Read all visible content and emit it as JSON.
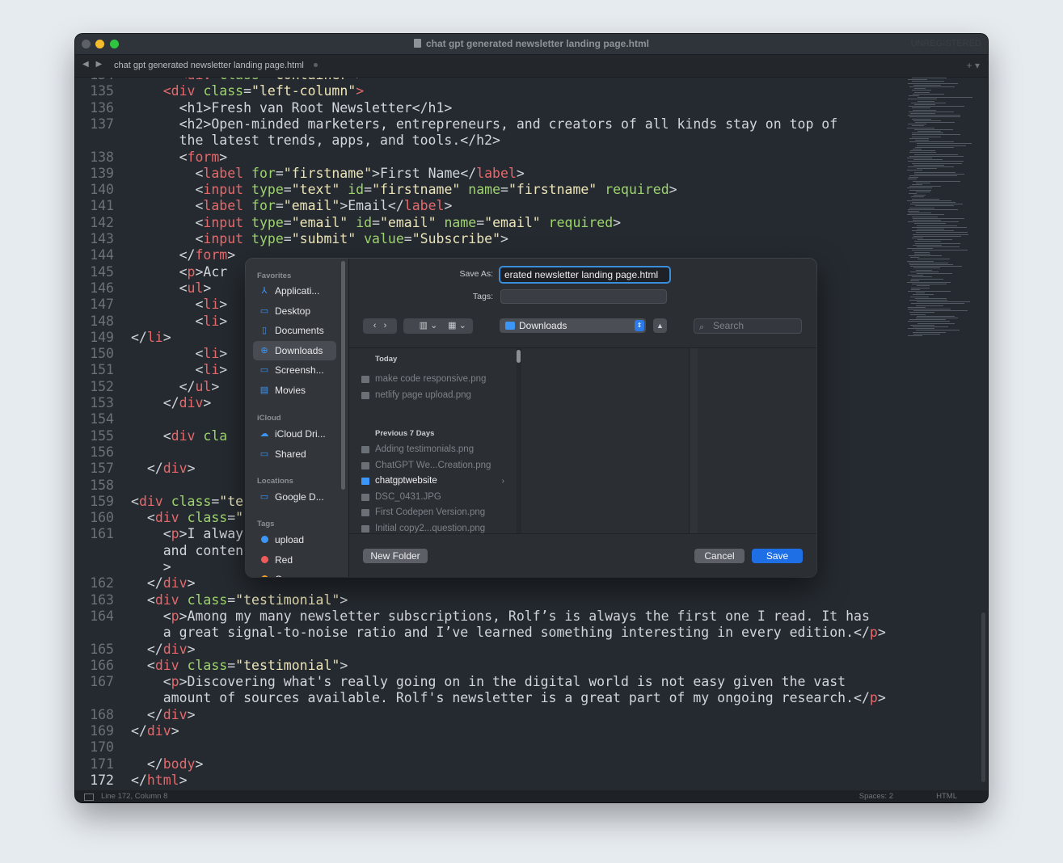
{
  "window": {
    "title": "chat gpt generated newsletter landing page.html",
    "unregistered": "UNREGISTERED",
    "tab_label": "chat gpt generated newsletter landing page.html",
    "tab_nav": "◀ ▶",
    "tab_actions": "+ ▾"
  },
  "editor": {
    "lines": [
      {
        "n": "134",
        "html": "      <span class='tg'>&lt;div</span> <span class='at'>class</span>=<span class='st'>\"container\"</span><span class='tg'>&gt;</span>"
      },
      {
        "n": "135",
        "html": "    <span class='tg'>&lt;div</span> <span class='at'>class</span>=<span class='st'>\"left-column\"</span><span class='tg'>&gt;</span>"
      },
      {
        "n": "136",
        "html": "      &lt;h1&gt;Fresh van Root Newsletter&lt;/h1&gt;"
      },
      {
        "n": "137",
        "html": "      &lt;h2&gt;Open-minded marketers, entrepreneurs, and creators of all kinds stay on top of"
      },
      {
        "n": "",
        "html": "      the latest trends, apps, and tools.&lt;/h2&gt;"
      },
      {
        "n": "138",
        "html": "      &lt;<span class='tg'>form</span>&gt;"
      },
      {
        "n": "139",
        "html": "        &lt;<span class='tg'>label</span> <span class='at'>for</span>=<span class='st'>\"firstname\"</span>&gt;First Name&lt;/<span class='tg'>label</span>&gt;"
      },
      {
        "n": "140",
        "html": "        &lt;<span class='tg'>input</span> <span class='at'>type</span>=<span class='st'>\"text\"</span> <span class='at'>id</span>=<span class='st'>\"firstname\"</span> <span class='at'>name</span>=<span class='st'>\"firstname\"</span> <span class='at'>required</span>&gt;"
      },
      {
        "n": "141",
        "html": "        &lt;<span class='tg'>label</span> <span class='at'>for</span>=<span class='st'>\"email\"</span>&gt;Email&lt;/<span class='tg'>label</span>&gt;"
      },
      {
        "n": "142",
        "html": "        &lt;<span class='tg'>input</span> <span class='at'>type</span>=<span class='st'>\"email\"</span> <span class='at'>id</span>=<span class='st'>\"email\"</span> <span class='at'>name</span>=<span class='st'>\"email\"</span> <span class='at'>required</span>&gt;"
      },
      {
        "n": "143",
        "html": "        &lt;<span class='tg'>input</span> <span class='at'>type</span>=<span class='st'>\"submit\"</span> <span class='at'>value</span>=<span class='st'>\"Subscribe\"</span>&gt;"
      },
      {
        "n": "144",
        "html": "      &lt;/<span class='tg'>form</span>&gt;"
      },
      {
        "n": "145",
        "html": "      &lt;<span class='tg'>p</span>&gt;Acr"
      },
      {
        "n": "146",
        "html": "      &lt;<span class='tg'>ul</span>&gt;"
      },
      {
        "n": "147",
        "html": "        &lt;<span class='tg'>li</span>&gt;"
      },
      {
        "n": "148",
        "html": "        &lt;<span class='tg'>li</span>&gt;"
      },
      {
        "n": "149",
        "html": "&lt;/<span class='tg'>li</span>&gt;"
      },
      {
        "n": "150",
        "html": "        &lt;<span class='tg'>li</span>&gt;"
      },
      {
        "n": "151",
        "html": "        &lt;<span class='tg'>li</span>&gt;"
      },
      {
        "n": "152",
        "html": "      &lt;/<span class='tg'>ul</span>&gt;"
      },
      {
        "n": "153",
        "html": "    &lt;/<span class='tg'>div</span>&gt;"
      },
      {
        "n": "154",
        "html": ""
      },
      {
        "n": "155",
        "html": "    &lt;<span class='tg'>div</span> <span class='at'>cla</span>"
      },
      {
        "n": "156",
        "html": ""
      },
      {
        "n": "157",
        "html": "  &lt;/<span class='tg'>div</span>&gt;"
      },
      {
        "n": "158",
        "html": ""
      },
      {
        "n": "159",
        "html": "&lt;<span class='tg'>div</span> <span class='at'>class</span>=<span class='st'>\"te</span>"
      },
      {
        "n": "160",
        "html": "  &lt;<span class='tg'>div</span> <span class='at'>class</span>=<span class='st'>\"</span>"
      },
      {
        "n": "161",
        "html": "    &lt;<span class='tg'>p</span>&gt;I alway                                                         arketing"
      },
      {
        "n": "",
        "html": "    and conten                                                         erials.&lt;/<span class='tg'>p</span>"
      },
      {
        "n": "",
        "html": "    &gt;"
      },
      {
        "n": "162",
        "html": "  &lt;/<span class='tg'>div</span>&gt;"
      },
      {
        "n": "163",
        "html": "  &lt;<span class='tg'>div</span> <span class='at'>class</span>=<span class='st'>\"testimonial\"</span>&gt;"
      },
      {
        "n": "164",
        "html": "    &lt;<span class='tg'>p</span>&gt;Among my many newsletter subscriptions, Rolf’s is always the first one I read. It has"
      },
      {
        "n": "",
        "html": "    a great signal-to-noise ratio and I’ve learned something interesting in every edition.&lt;/<span class='tg'>p</span>&gt;"
      },
      {
        "n": "165",
        "html": "  &lt;/<span class='tg'>div</span>&gt;"
      },
      {
        "n": "166",
        "html": "  &lt;<span class='tg'>div</span> <span class='at'>class</span>=<span class='st'>\"testimonial\"</span>&gt;"
      },
      {
        "n": "167",
        "html": "    &lt;<span class='tg'>p</span>&gt;Discovering what's really going on in the digital world is not easy given the vast"
      },
      {
        "n": "",
        "html": "    amount of sources available. Rolf's newsletter is a great part of my ongoing research.&lt;/<span class='tg'>p</span>&gt;"
      },
      {
        "n": "168",
        "html": "  &lt;/<span class='tg'>div</span>&gt;"
      },
      {
        "n": "169",
        "html": "&lt;/<span class='tg'>div</span>&gt;"
      },
      {
        "n": "170",
        "html": ""
      },
      {
        "n": "171",
        "html": "  &lt;/<span class='tg'>body</span>&gt;"
      },
      {
        "n": "172",
        "html": "&lt;/<span class='tg'>html</span>&gt;"
      }
    ],
    "active_line": "172"
  },
  "statusbar": {
    "position": "Line 172, Column 8",
    "spaces": "Spaces: 2",
    "syntax": "HTML"
  },
  "dialog": {
    "save_as_label": "Save As:",
    "save_as_value": "erated newsletter landing page.html",
    "tags_label": "Tags:",
    "location": "Downloads",
    "search_placeholder": "Search",
    "view_columns_icon": "columns-icon",
    "view_grid_icon": "grid-icon",
    "sidebar": {
      "favorites_title": "Favorites",
      "favorites": [
        {
          "label": "Applicati...",
          "icon": "⅄"
        },
        {
          "label": "Desktop",
          "icon": "▭"
        },
        {
          "label": "Documents",
          "icon": "▯"
        },
        {
          "label": "Downloads",
          "icon": "⊕"
        },
        {
          "label": "Screensh...",
          "icon": "▭"
        },
        {
          "label": "Movies",
          "icon": "▤"
        }
      ],
      "icloud_title": "iCloud",
      "icloud": [
        {
          "label": "iCloud Dri...",
          "icon": "☁"
        },
        {
          "label": "Shared",
          "icon": "▭"
        }
      ],
      "locations_title": "Locations",
      "locations": [
        {
          "label": "Google D...",
          "icon": "▭"
        }
      ],
      "tags_title": "Tags",
      "tags": [
        {
          "label": "upload",
          "color": "#3c96f7"
        },
        {
          "label": "Red",
          "color": "#ef5b5b"
        },
        {
          "label": "Orange",
          "color": "#f0a030"
        }
      ]
    },
    "today_title": "Today",
    "today_files": [
      "make code responsive.png",
      "netlify page upload.png"
    ],
    "prev_title": "Previous 7 Days",
    "prev_files": [
      {
        "name": "Adding testimonials.png",
        "folder": false
      },
      {
        "name": "ChatGPT We...Creation.png",
        "folder": false
      },
      {
        "name": "chatgptwebsite",
        "folder": true
      },
      {
        "name": "DSC_0431.JPG",
        "folder": false
      },
      {
        "name": "First Codepen Version.png",
        "folder": false
      },
      {
        "name": "Initial copy2...question.png",
        "folder": false
      }
    ],
    "new_folder": "New Folder",
    "cancel": "Cancel",
    "save": "Save"
  }
}
